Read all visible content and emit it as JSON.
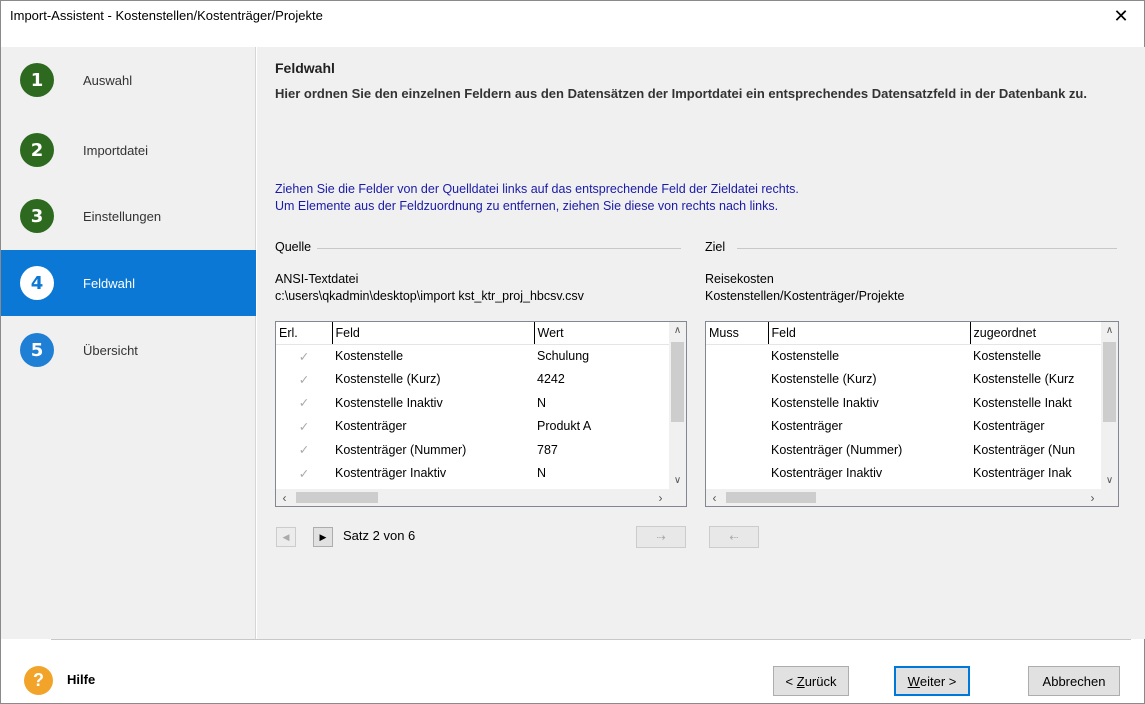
{
  "window": {
    "title": "Import-Assistent - Kostenstellen/Kostenträger/Projekte",
    "close_glyph": "✕"
  },
  "steps": [
    {
      "number": "1",
      "label": "Auswahl",
      "state": "done"
    },
    {
      "number": "2",
      "label": "Importdatei",
      "state": "done"
    },
    {
      "number": "3",
      "label": "Einstellungen",
      "state": "done"
    },
    {
      "number": "4",
      "label": "Feldwahl",
      "state": "active"
    },
    {
      "number": "5",
      "label": "Übersicht",
      "state": "todo"
    }
  ],
  "page": {
    "heading": "Feldwahl",
    "subheading": "Hier ordnen Sie den einzelnen Feldern aus den Datensätzen der Importdatei ein entsprechendes Datensatzfeld in der Datenbank zu.",
    "hint_line1": "Ziehen Sie die Felder von der Quelldatei links auf das entsprechende Feld der Zieldatei rechts.",
    "hint_line2": "Um Elemente aus der Feldzuordnung zu entfernen, ziehen Sie diese von rechts nach links."
  },
  "source": {
    "group_label": "Quelle",
    "type": "ANSI-Textdatei",
    "path": "c:\\users\\qkadmin\\desktop\\import kst_ktr_proj_hbcsv.csv",
    "columns": [
      "Erl.",
      "Feld",
      "Wert"
    ],
    "rows": [
      {
        "check": "✓",
        "field": "Kostenstelle",
        "value": "Schulung"
      },
      {
        "check": "✓",
        "field": "Kostenstelle (Kurz)",
        "value": "4242"
      },
      {
        "check": "✓",
        "field": "Kostenstelle Inaktiv",
        "value": "N"
      },
      {
        "check": "✓",
        "field": "Kostenträger",
        "value": "Produkt A"
      },
      {
        "check": "✓",
        "field": "Kostenträger (Nummer)",
        "value": "787"
      },
      {
        "check": "✓",
        "field": "Kostenträger Inaktiv",
        "value": "N"
      }
    ]
  },
  "target": {
    "group_label": "Ziel",
    "line1": "Reisekosten",
    "line2": "Kostenstellen/Kostenträger/Projekte",
    "columns": [
      "Muss",
      "Feld",
      "zugeordnet"
    ],
    "rows": [
      {
        "muss": "",
        "field": "Kostenstelle",
        "assigned": "Kostenstelle"
      },
      {
        "muss": "",
        "field": "Kostenstelle (Kurz)",
        "assigned": "Kostenstelle (Kurz"
      },
      {
        "muss": "",
        "field": "Kostenstelle Inaktiv",
        "assigned": "Kostenstelle Inakt"
      },
      {
        "muss": "",
        "field": "Kostenträger",
        "assigned": "Kostenträger"
      },
      {
        "muss": "",
        "field": "Kostenträger (Nummer)",
        "assigned": "Kostenträger (Nun"
      },
      {
        "muss": "",
        "field": "Kostenträger Inaktiv",
        "assigned": "Kostenträger Inak"
      }
    ]
  },
  "navigation": {
    "record_label": "Satz 2 von 6"
  },
  "footer": {
    "help_glyph": "?",
    "help_label": "Hilfe",
    "back_label_prefix": "< ",
    "back_label_u": "Z",
    "back_label_rest": "urück",
    "next_label_u": "W",
    "next_label_rest": "eiter >",
    "cancel_label": "Abbrechen"
  },
  "colors": {
    "step_done": "#2d6a1f",
    "step_active_bg": "#0a78d4",
    "step_todo": "#1e7fd4",
    "hint_text": "#1a1aa8",
    "help_icon": "#f2a42a"
  }
}
